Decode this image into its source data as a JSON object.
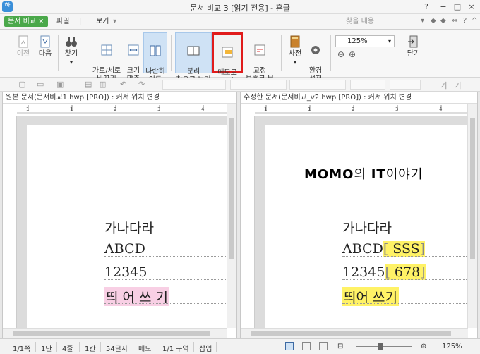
{
  "titlebar": {
    "app_icon": "한",
    "title": "문서 비교 3 [읽기 전용] - 혼글",
    "buttons": [
      "?",
      "−",
      "□",
      "×"
    ]
  },
  "tabs": {
    "compare": "문서 비교 ×",
    "file": "파일",
    "view": "보기",
    "search_placeholder": "찾을 내용"
  },
  "ribbon": {
    "prev": "이전",
    "next": "다음",
    "find": "찾기",
    "orient": "가로/세로\n바꾸기",
    "fit": "크기\n맞춤",
    "side_move": "나란히\n이동",
    "separate": "분리\n창으로 보기",
    "memo": "메모로\n보기",
    "proof": "교정\n부호로 보기",
    "dict": "사전",
    "env": "환경\n설정",
    "zoom": "125%",
    "close": "닫기"
  },
  "left_pane": {
    "title": "원본 문서(문서비교1.hwp [PRO]) : 커서 위치 변경",
    "lines": [
      "가나다라",
      "ABCD",
      "12345",
      "띄 어  쓰 기"
    ]
  },
  "right_pane": {
    "title": "수정한 문서(문서비교_v2.hwp [PRO]) : 커서 위치 변경",
    "watermark_a": "MOMO",
    "watermark_b": "의 ",
    "watermark_c": "IT",
    "watermark_d": "이야기",
    "lines": [
      "가나다라",
      "ABCD",
      "SSS",
      "12345",
      "678",
      "띄어  쓰기"
    ]
  },
  "status": {
    "page": "1/1쪽",
    "section": "1단",
    "line": "4줄",
    "col": "1칸",
    "chars": "54글자",
    "memo": "메모",
    "area": "1/1 구역",
    "insert": "삽입",
    "zoom": "125%"
  },
  "colors": {
    "accent_green": "#4aa84a",
    "highlight_red": "#e01b1b",
    "delete_pink": "#f8cfe4",
    "insert_yellow": "#fff266"
  }
}
